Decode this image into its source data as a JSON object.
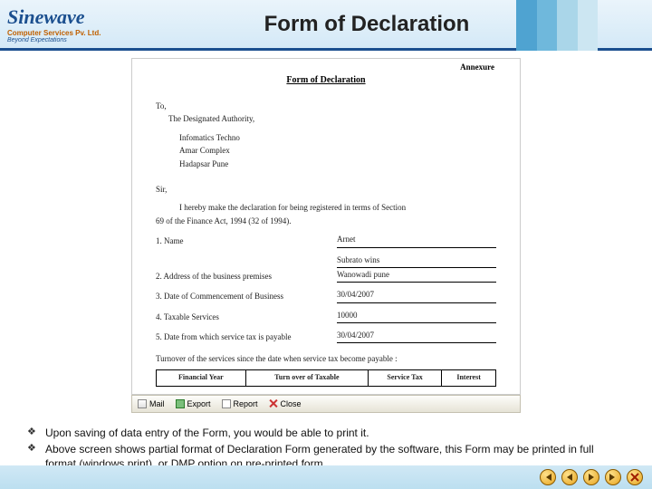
{
  "header": {
    "logo_word": "Sinewave",
    "logo_sub1": "Computer Services Pv. Ltd.",
    "logo_sub2": "Beyond Expectations",
    "title": "Form of Declaration"
  },
  "doc": {
    "annexure": "Annexure",
    "title": "Form of Declaration",
    "to": "To,",
    "auth": "The Designated Authority,",
    "addr1": "Infomatics Techno",
    "addr2": "Amar Complex",
    "addr3": "Hadapsar Pune",
    "sir": "Sir,",
    "decl_line1": "I hereby make the declaration for being registered in terms of Section",
    "decl_line2": "69 of the Finance Act, 1994 (32 of 1994).",
    "r1_lbl": "1. Name",
    "r1_val": "Arnet",
    "r2_lbl": "2. Address of the business premises",
    "r2_val1": "Subrato wins",
    "r2_val2": "Wanowadi pune",
    "r3_lbl": "3. Date of Commencement of Business",
    "r3_val": "30/04/2007",
    "r4_lbl": "4. Taxable Services",
    "r4_val": "10000",
    "r5_lbl": "5. Date from which service tax is payable",
    "r5_val": "30/04/2007",
    "turnover": "Turnover of the services since the date when service tax become payable :",
    "th1": "Financial Year",
    "th2": "Turn over of Taxable",
    "th3": "Service Tax",
    "th4": "Interest"
  },
  "toolbar": {
    "mail": "Mail",
    "export": "Export",
    "report": "Report",
    "close": "Close"
  },
  "notes": {
    "n1": "Upon saving of data entry of the Form, you would be able to  print it.",
    "n2": "Above screen shows partial format of Declaration Form generated by the software, this Form may be printed in full format (windows print), or DMP option on pre-printed form."
  }
}
